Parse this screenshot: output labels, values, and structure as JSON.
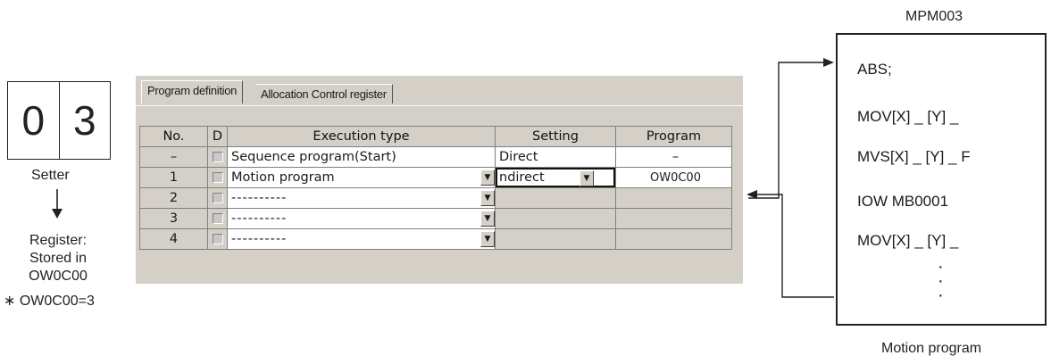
{
  "setter": {
    "digits": [
      "0",
      "3"
    ],
    "label": "Setter",
    "register_lines": [
      "Register:",
      "Stored in",
      "OW0C00"
    ],
    "note": "∗ OW0C00=3"
  },
  "window": {
    "tabs": [
      "Program definition",
      "Allocation Control register"
    ],
    "headers": [
      "No.",
      "D",
      "Execution type",
      "Setting",
      "Program"
    ],
    "rows": [
      {
        "no": "–",
        "type": "Sequence program(Start)",
        "setting": "Direct",
        "program": "–"
      },
      {
        "no": "1",
        "type": "Motion program",
        "setting": "ndirect",
        "program": "OW0C00"
      },
      {
        "no": "2",
        "type": "----------",
        "setting": "",
        "program": ""
      },
      {
        "no": "3",
        "type": "----------",
        "setting": "",
        "program": ""
      },
      {
        "no": "4",
        "type": "----------",
        "setting": "",
        "program": ""
      }
    ]
  },
  "program_box": {
    "title": "MPM003",
    "lines": [
      "ABS;",
      "MOV[X] _ [Y] _",
      "MVS[X] _ [Y] _ F",
      "IOW MB0001",
      "MOV[X] _ [Y] _"
    ],
    "ellipsis": [
      "·",
      "·",
      "·"
    ],
    "caption": "Motion program"
  }
}
